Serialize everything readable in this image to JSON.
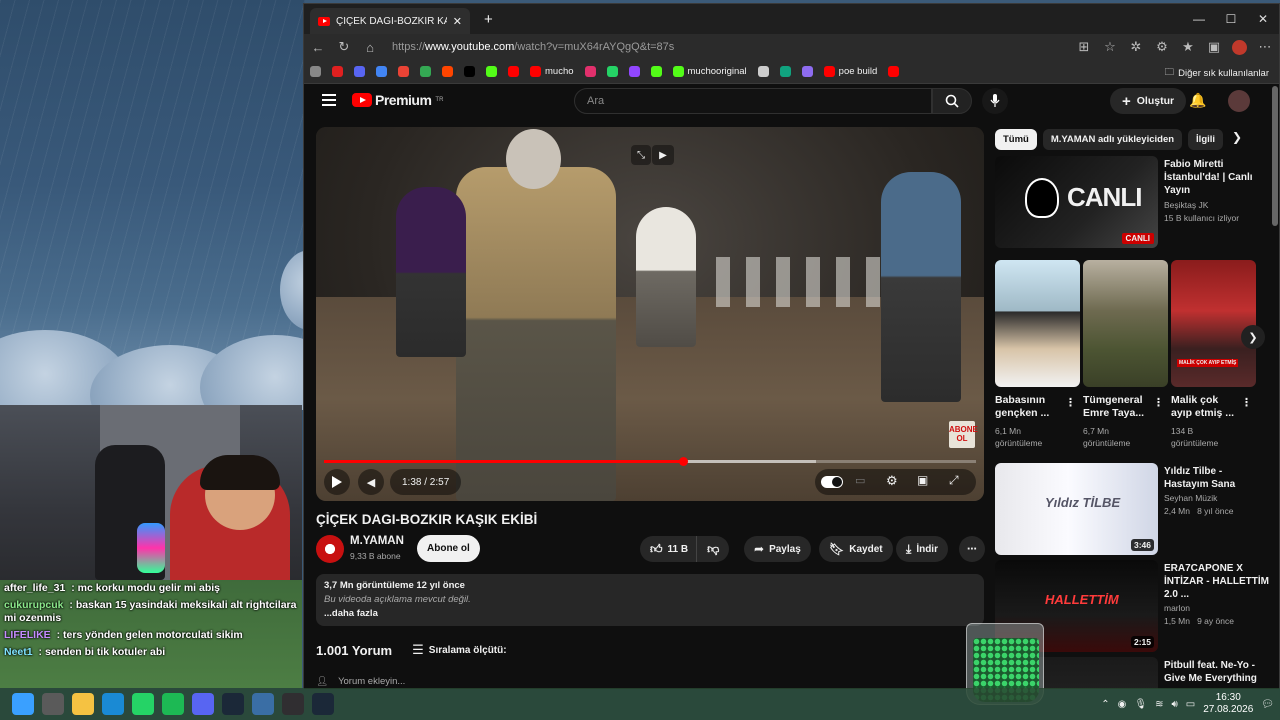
{
  "browser": {
    "tab_title": "ÇİÇEK DAGI-BOZKIR KAŞIK EKİBİ -",
    "url_prefix": "https://",
    "url_domain": "www.youtube.com",
    "url_path": "/watch?v=muX64rAYQgQ&t=87s",
    "bookmarks": [
      {
        "label": "",
        "color": "#888888"
      },
      {
        "label": "",
        "color": "#e02020"
      },
      {
        "label": "",
        "color": "#5865f2"
      },
      {
        "label": "",
        "color": "#4285f4"
      },
      {
        "label": "",
        "color": "#ea4335"
      },
      {
        "label": "",
        "color": "#34a853"
      },
      {
        "label": "",
        "color": "#ff4500"
      },
      {
        "label": "",
        "color": "#000000"
      },
      {
        "label": "",
        "color": "#53fc18"
      },
      {
        "label": "",
        "color": "#ff0000"
      },
      {
        "label": "mucho",
        "color": "#ff0000"
      },
      {
        "label": "",
        "color": "#e1306c"
      },
      {
        "label": "",
        "color": "#25d366"
      },
      {
        "label": "",
        "color": "#9146ff"
      },
      {
        "label": "",
        "color": "#53fc18"
      },
      {
        "label": "muchooriginal",
        "color": "#53fc18"
      },
      {
        "label": "",
        "color": "#cccccc"
      },
      {
        "label": "",
        "color": "#10a37f"
      },
      {
        "label": "",
        "color": "#8e6cf0"
      },
      {
        "label": "poe build",
        "color": "#ff0000"
      },
      {
        "label": "",
        "color": "#ff0000"
      }
    ],
    "other_bookmarks": "Diğer sık kullanılanlar"
  },
  "youtube": {
    "logo_text": "Premium",
    "logo_sup": "TR",
    "search_placeholder": "Ara",
    "create_label": "Oluştur",
    "video": {
      "time": "1:38 / 2:57",
      "progress": 0.551,
      "buffered": 0.755,
      "watermark": "ABONE OL",
      "title": "ÇİÇEK DAGI-BOZKIR KAŞIK EKİBİ"
    },
    "channel": {
      "name": "M.YAMAN",
      "subs": "9,33 B abone",
      "subscribe": "Abone ol"
    },
    "actions": {
      "likes": "11 B",
      "share": "Paylaş",
      "save": "Kaydet",
      "download": "İndir"
    },
    "description": {
      "stats": "3,7 Mn görüntüleme  12 yıl önce",
      "empty": "Bu videoda açıklama mevcut değil.",
      "more": "...daha fazla"
    },
    "comments": {
      "count": "1.001 Yorum",
      "sort": "Sıralama ölçütü:",
      "add": "Yorum ekleyin..."
    },
    "chips": [
      "Tümü",
      "M.YAMAN adlı yükleyiciden",
      "İlgili"
    ],
    "rec_live": {
      "title": "Fabio Miretti İstanbul'da! | Canlı Yayın",
      "channel": "Beşiktaş JK",
      "meta": "15 B kullanıcı izliyor",
      "thumb_text": "CANLI",
      "badge": "CANLI"
    },
    "shorts": [
      {
        "title": "Babasının gençken ...",
        "views": "6,1 Mn",
        "views_unit": "görüntüleme"
      },
      {
        "title": "Tümgeneral Emre Taya...",
        "views": "6,7 Mn",
        "views_unit": "görüntüleme"
      },
      {
        "title": "Malik çok ayıp etmiş ...",
        "views": "134 B",
        "views_unit": "görüntüleme",
        "thumb_caption": "MALİK ÇOK AYIP ETMİŞ"
      }
    ],
    "rec_list": [
      {
        "title": "Yıldız Tilbe - Hastayım Sana",
        "channel": "Seyhan Müzik",
        "meta": "2,4 Mn   8 yıl önce",
        "duration": "3:46",
        "thumb_text": "Yıldız TİLBE"
      },
      {
        "title": "ERA7CAPONE X İNTİZAR - HALLETTİM 2.0 ...",
        "channel": "marlon",
        "meta": "1,5 Mn   9 ay önce",
        "duration": "2:15",
        "thumb_text": "HALLETTİM"
      },
      {
        "title": "Pitbull feat. Ne-Yo - Give Me Everything",
        "channel": "",
        "meta": "",
        "duration": "",
        "thumb_text": ""
      }
    ]
  },
  "chat": [
    {
      "user": "after_life_31",
      "color": "#ffffff",
      "msg": "mc korku modu gelir mi abiş"
    },
    {
      "user": "cukurupcuk",
      "color": "#8be88b",
      "msg": "baskan 15 yasindaki meksikali alt rightcilara mi ozenmis"
    },
    {
      "user": "LIFELIKE",
      "color": "#c58cff",
      "msg": "ters yönden gelen motorculati sikim"
    },
    {
      "user": "Neet1",
      "color": "#7fe3ff",
      "msg": "senden bi tik kotuler abi"
    }
  ],
  "taskbar": {
    "apps": [
      {
        "icon": "windows-icon",
        "color": "#3aa0ff"
      },
      {
        "icon": "calculator-icon",
        "color": "#5a5a5a"
      },
      {
        "icon": "folder-icon",
        "color": "#f5c242"
      },
      {
        "icon": "edge-icon",
        "color": "#1a8ad4"
      },
      {
        "icon": "whatsapp-icon",
        "color": "#25d366"
      },
      {
        "icon": "spotify-icon",
        "color": "#1db954"
      },
      {
        "icon": "discord-icon",
        "color": "#5865f2"
      },
      {
        "icon": "steam-icon",
        "color": "#1b2838"
      },
      {
        "icon": "vpn-icon",
        "color": "#3a6ea5"
      },
      {
        "icon": "obs-icon",
        "color": "#302e31"
      },
      {
        "icon": "steam-icon",
        "color": "#1b2838"
      }
    ],
    "time": "16:30",
    "date": "27.08.2026"
  }
}
